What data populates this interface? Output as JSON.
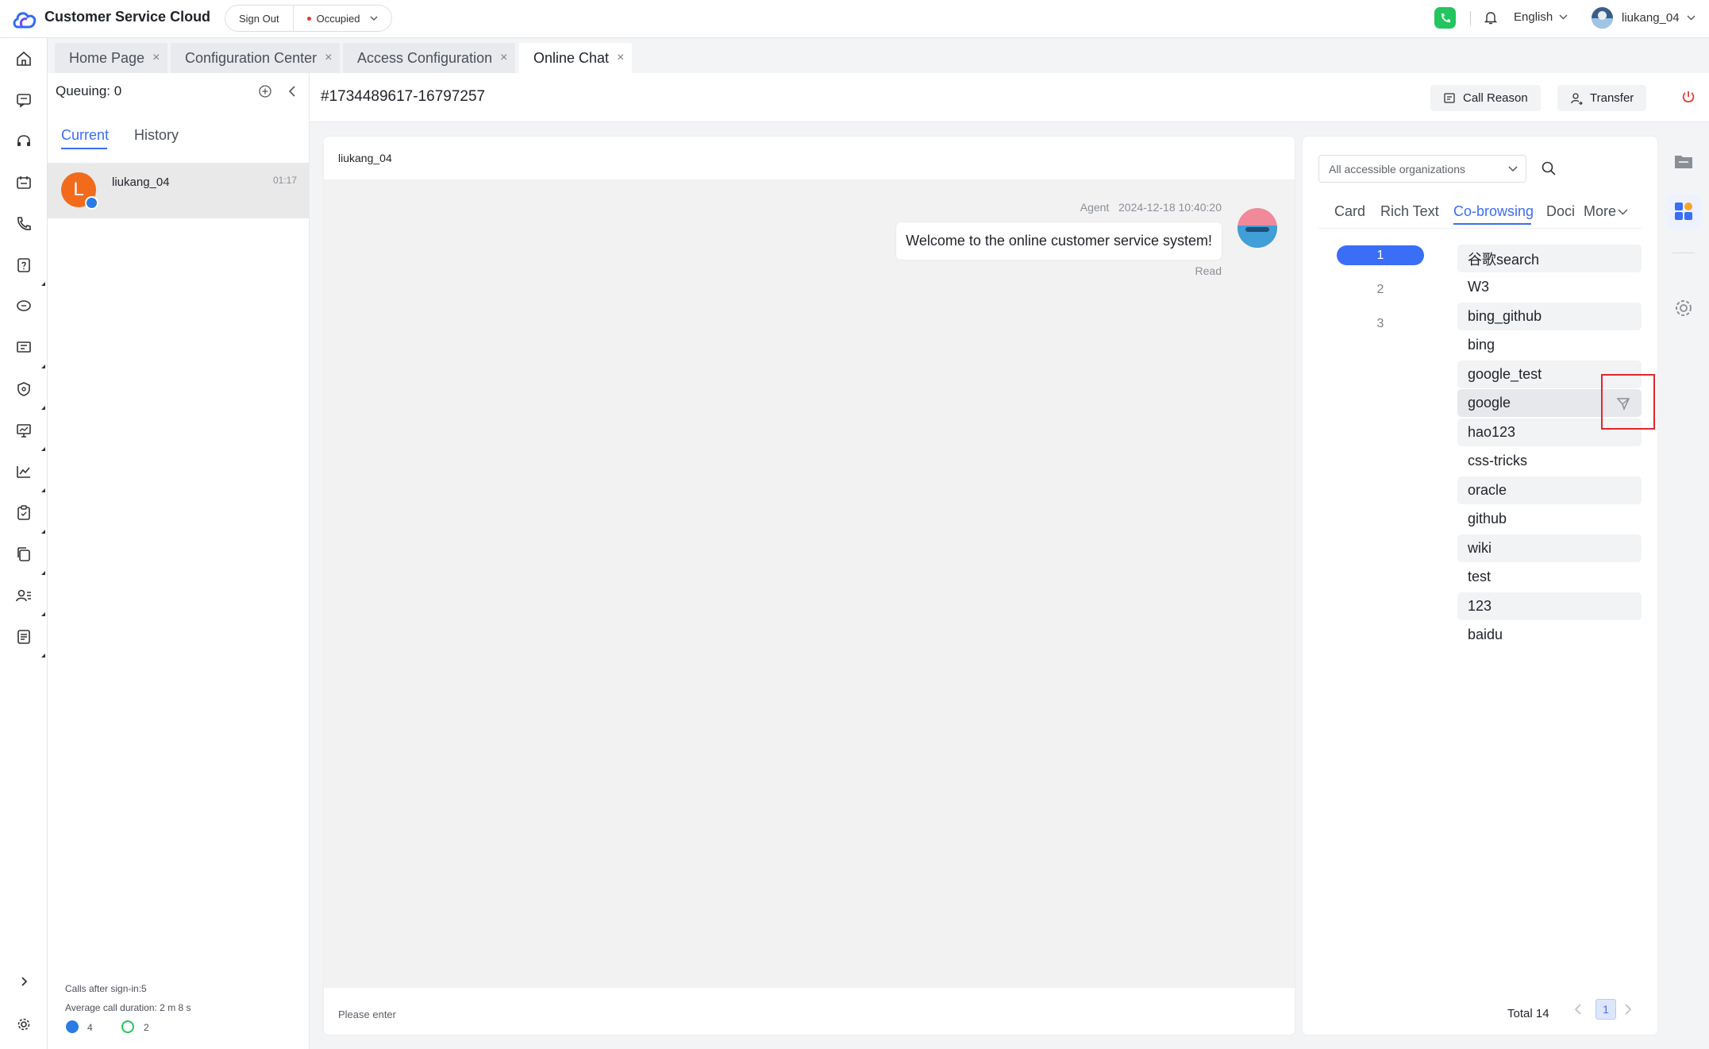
{
  "app": {
    "brand": "Customer Service Cloud",
    "sign_out": "Sign Out",
    "status": "Occupied",
    "language": "English",
    "user": "liukang_04"
  },
  "tabs": [
    {
      "label": "Home Page",
      "active": false
    },
    {
      "label": "Configuration Center",
      "active": false
    },
    {
      "label": "Access Configuration",
      "active": false
    },
    {
      "label": "Online Chat",
      "active": true
    }
  ],
  "queue": {
    "title": "Queuing: 0",
    "subtabs": [
      "Current",
      "History"
    ],
    "conversation": {
      "initial": "L",
      "name": "liukang_04",
      "time": "01:17"
    },
    "stats": {
      "calls_after_signin": "Calls after sign-in:5",
      "avg_duration": "Average call duration: 2 m 8 s",
      "count_blue": "4",
      "count_green": "2"
    }
  },
  "session": {
    "id": "#1734489617-16797257",
    "call_reason": "Call Reason",
    "transfer": "Transfer"
  },
  "chat": {
    "customer": "liukang_04",
    "message": {
      "sender": "Agent",
      "timestamp": "2024-12-18 10:40:20",
      "text": "Welcome to the online customer service system!",
      "receipt": "Read"
    },
    "input_placeholder": "Please enter"
  },
  "cobrowse": {
    "org_select": "All accessible organizations",
    "tabs": [
      "Card",
      "Rich Text",
      "Co-browsing",
      "Doci",
      "More"
    ],
    "active_tab": "Co-browsing",
    "numbers": [
      "1",
      "2",
      "3"
    ],
    "items": [
      "谷歌search",
      "W3",
      "bing_github",
      "bing",
      "google_test",
      "google",
      "hao123",
      "css-tricks",
      "oracle",
      "github",
      "wiki",
      "test",
      "123",
      "baidu"
    ],
    "total": "Total 14",
    "page": "1"
  },
  "colors": {
    "accent": "#3b6ef7",
    "status_red": "#e53935",
    "avatar_orange": "#f26b1d",
    "phone_green": "#22c55e",
    "highlight": "#e3262b"
  }
}
